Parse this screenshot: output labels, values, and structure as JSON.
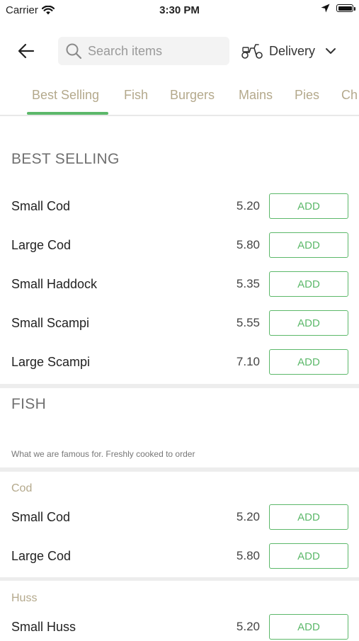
{
  "status_bar": {
    "carrier": "Carrier",
    "time": "3:30 PM"
  },
  "header": {
    "search_placeholder": "Search items",
    "delivery_label": "Delivery",
    "icons": [
      "back-arrow-icon",
      "search-icon",
      "scooter-icon",
      "chevron-down-icon"
    ]
  },
  "tabs": [
    "Best Selling",
    "Fish",
    "Burgers",
    "Mains",
    "Pies",
    "Ch"
  ],
  "best_selling": {
    "title": "BEST SELLING",
    "items": [
      {
        "name": "Small Cod",
        "price": "5.20",
        "action": "ADD"
      },
      {
        "name": "Large Cod",
        "price": "5.80",
        "action": "ADD"
      },
      {
        "name": "Small Haddock",
        "price": "5.35",
        "action": "ADD"
      },
      {
        "name": "Small Scampi",
        "price": "5.55",
        "action": "ADD"
      },
      {
        "name": "Large Scampi",
        "price": "7.10",
        "action": "ADD"
      }
    ]
  },
  "fish": {
    "title": "FISH",
    "description": "What we are famous for. Freshly cooked to order",
    "cod": {
      "title": "Cod",
      "items": [
        {
          "name": "Small Cod",
          "price": "5.20",
          "action": "ADD"
        },
        {
          "name": "Large Cod",
          "price": "5.80",
          "action": "ADD"
        }
      ]
    },
    "huss": {
      "title": "Huss",
      "items": [
        {
          "name": "Small Huss",
          "price": "5.20",
          "action": "ADD"
        }
      ]
    }
  },
  "colors": {
    "accent": "#5cb86a",
    "tab_text": "#b4a98c",
    "divider": "#ededed"
  }
}
